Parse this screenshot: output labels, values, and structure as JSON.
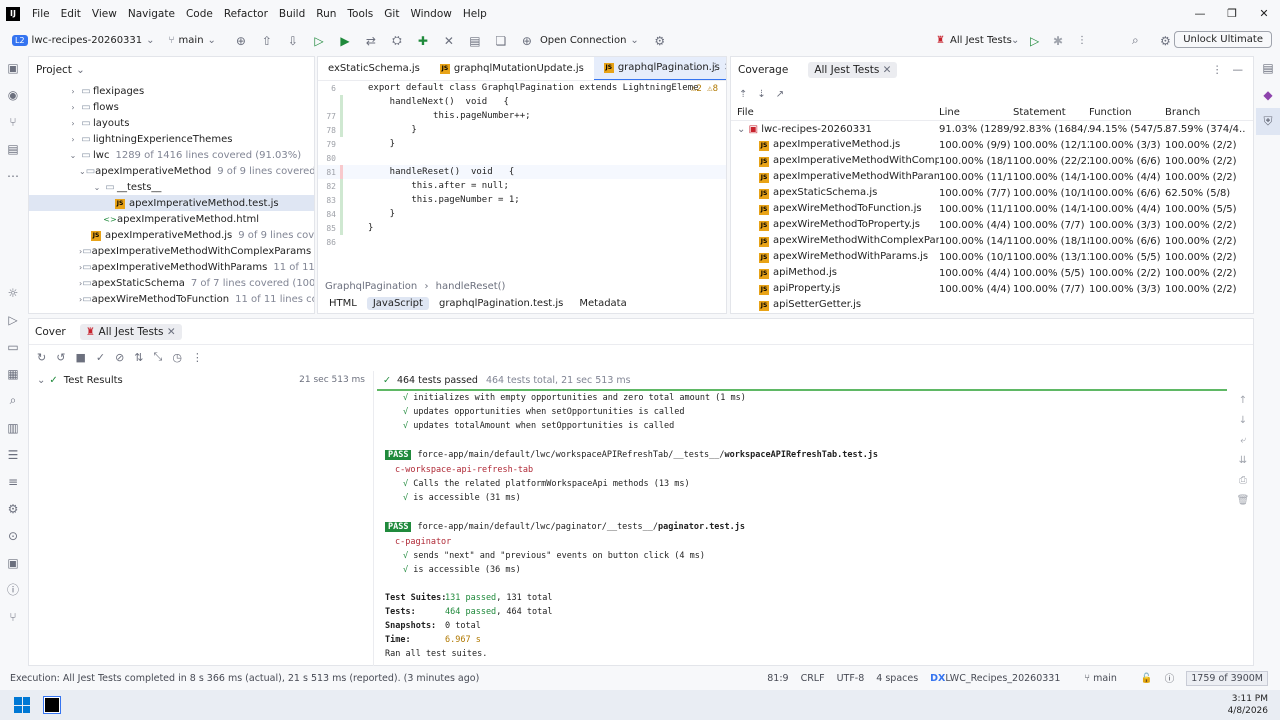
{
  "menu": {
    "logo": "IJ",
    "items": [
      "File",
      "Edit",
      "View",
      "Navigate",
      "Code",
      "Refactor",
      "Build",
      "Run",
      "Tools",
      "Git",
      "Window",
      "Help"
    ]
  },
  "toolbar": {
    "project_badge": "L2",
    "project_name": "lwc-recipes-20260331",
    "branch": "main",
    "open_connection": "Open Connection",
    "run_config": "All Jest Tests",
    "unlock": "Unlock Ultimate"
  },
  "project_panel": {
    "title": "Project",
    "rows": [
      {
        "indent": 4,
        "arrow": "›",
        "icon": "folder",
        "name": "flexipages",
        "note": ""
      },
      {
        "indent": 4,
        "arrow": "›",
        "icon": "folder",
        "name": "flows",
        "note": ""
      },
      {
        "indent": 4,
        "arrow": "›",
        "icon": "folder",
        "name": "layouts",
        "note": ""
      },
      {
        "indent": 4,
        "arrow": "›",
        "icon": "folder",
        "name": "lightningExperienceThemes",
        "note": ""
      },
      {
        "indent": 4,
        "arrow": "⌄",
        "icon": "folder",
        "name": "lwc",
        "note": "1289 of 1416 lines covered (91.03%)"
      },
      {
        "indent": 5,
        "arrow": "⌄",
        "icon": "folder",
        "name": "apexImperativeMethod",
        "note": "9 of 9 lines covered ("
      },
      {
        "indent": 6,
        "arrow": "⌄",
        "icon": "folder",
        "name": "__tests__",
        "note": ""
      },
      {
        "indent": 7,
        "arrow": "",
        "icon": "js",
        "name": "apexImperativeMethod.test.js",
        "note": "",
        "sel": true
      },
      {
        "indent": 6,
        "arrow": "",
        "icon": "html",
        "name": "apexImperativeMethod.html",
        "note": ""
      },
      {
        "indent": 6,
        "arrow": "",
        "icon": "js",
        "name": "apexImperativeMethod.js",
        "note": "9 of 9 lines cov"
      },
      {
        "indent": 5,
        "arrow": "›",
        "icon": "folder",
        "name": "apexImperativeMethodWithComplexParams",
        "note": "1"
      },
      {
        "indent": 5,
        "arrow": "›",
        "icon": "folder",
        "name": "apexImperativeMethodWithParams",
        "note": "11 of 11 lin"
      },
      {
        "indent": 5,
        "arrow": "›",
        "icon": "folder",
        "name": "apexStaticSchema",
        "note": "7 of 7 lines covered (100.0"
      },
      {
        "indent": 5,
        "arrow": "›",
        "icon": "folder",
        "name": "apexWireMethodToFunction",
        "note": "11 of 11 lines cov"
      }
    ]
  },
  "editor": {
    "tabs": [
      "exStaticSchema.js",
      "graphqlMutationUpdate.js",
      "graphqlPagination.js"
    ],
    "lines": [
      {
        "n": "6",
        "t": "export default class GraphqlPagination extends LightningEleme"
      },
      {
        "n": "",
        "t": "    handleNext()  void   {"
      },
      {
        "n": "77",
        "t": "            this.pageNumber++;"
      },
      {
        "n": "78",
        "t": "        }"
      },
      {
        "n": "79",
        "t": "    }"
      },
      {
        "n": "80",
        "t": ""
      },
      {
        "n": "81",
        "t": "    handleReset()  void   {"
      },
      {
        "n": "82",
        "t": "        this.after = null;"
      },
      {
        "n": "83",
        "t": "        this.pageNumber = 1;"
      },
      {
        "n": "84",
        "t": "    }"
      },
      {
        "n": "85",
        "t": "}"
      },
      {
        "n": "86",
        "t": ""
      }
    ],
    "warnings": "⚠2  ⚠8",
    "breadcrumb": [
      "GraphqlPagination",
      "handleReset()"
    ],
    "bottom_tabs": [
      "HTML",
      "JavaScript",
      "graphqlPagination.test.js",
      "Metadata"
    ]
  },
  "coverage": {
    "title": "Coverage",
    "tab": "All Jest Tests",
    "headers": [
      "File",
      "Line",
      "Statement",
      "Function",
      "Branch"
    ],
    "rows": [
      {
        "name": "lwc-recipes-20260331",
        "line": "91.03% (1289/1...",
        "stmt": "92.83% (1684/...",
        "func": "94.15% (547/5...",
        "branch": "87.59% (374/4...",
        "root": true
      },
      {
        "name": "apexImperativeMethod.js",
        "line": "100.00% (9/9)",
        "stmt": "100.00% (12/12)",
        "func": "100.00% (3/3)",
        "branch": "100.00% (2/2)"
      },
      {
        "name": "apexImperativeMethodWithComplexParar",
        "line": "100.00% (18/18)",
        "stmt": "100.00% (22/22)",
        "func": "100.00% (6/6)",
        "branch": "100.00% (2/2)"
      },
      {
        "name": "apexImperativeMethodWithParams.js",
        "line": "100.00% (11/11)",
        "stmt": "100.00% (14/14)",
        "func": "100.00% (4/4)",
        "branch": "100.00% (2/2)"
      },
      {
        "name": "apexStaticSchema.js",
        "line": "100.00% (7/7)",
        "stmt": "100.00% (10/10)",
        "func": "100.00% (6/6)",
        "branch": "62.50% (5/8)"
      },
      {
        "name": "apexWireMethodToFunction.js",
        "line": "100.00% (11/11)",
        "stmt": "100.00% (14/14)",
        "func": "100.00% (4/4)",
        "branch": "100.00% (5/5)"
      },
      {
        "name": "apexWireMethodToProperty.js",
        "line": "100.00% (4/4)",
        "stmt": "100.00% (7/7)",
        "func": "100.00% (3/3)",
        "branch": "100.00% (2/2)"
      },
      {
        "name": "apexWireMethodWithComplexParams.js",
        "line": "100.00% (14/14)",
        "stmt": "100.00% (18/18)",
        "func": "100.00% (6/6)",
        "branch": "100.00% (2/2)"
      },
      {
        "name": "apexWireMethodWithParams.js",
        "line": "100.00% (10/10)",
        "stmt": "100.00% (13/13)",
        "func": "100.00% (5/5)",
        "branch": "100.00% (2/2)"
      },
      {
        "name": "apiMethod.js",
        "line": "100.00% (4/4)",
        "stmt": "100.00% (5/5)",
        "func": "100.00% (2/2)",
        "branch": "100.00% (2/2)"
      },
      {
        "name": "apiProperty.js",
        "line": "100.00% (4/4)",
        "stmt": "100.00% (7/7)",
        "func": "100.00% (3/3)",
        "branch": "100.00% (2/2)"
      },
      {
        "name": "apiSetterGetter.js",
        "line": "",
        "stmt": "",
        "func": "",
        "branch": ""
      }
    ]
  },
  "test": {
    "tabs": [
      "Cover",
      "All Jest Tests"
    ],
    "results_label": "Test Results",
    "results_time": "21 sec 513 ms",
    "status": "464 tests passed",
    "status_detail": "464 tests total, 21 sec 513 ms",
    "console": [
      {
        "k": "chk",
        "t": "initializes with empty opportunities and zero total amount (1 ms)"
      },
      {
        "k": "chk",
        "t": "updates opportunities when setOpportunities is called"
      },
      {
        "k": "chk",
        "t": "updates totalAmount when setOpportunities is called"
      },
      {
        "k": "blank",
        "t": ""
      },
      {
        "k": "pass",
        "badge": "PASS",
        "path": "force-app/main/default/lwc/workspaceAPIRefreshTab/__tests__/",
        "file": "workspaceAPIRefreshTab.test.js"
      },
      {
        "k": "suite",
        "t": "c-workspace-api-refresh-tab"
      },
      {
        "k": "chk",
        "t": "Calls the related platformWorkspaceApi methods (13 ms)"
      },
      {
        "k": "chk",
        "t": "is accessible (31 ms)"
      },
      {
        "k": "blank",
        "t": ""
      },
      {
        "k": "pass",
        "badge": "PASS",
        "path": "force-app/main/default/lwc/paginator/__tests__/",
        "file": "paginator.test.js"
      },
      {
        "k": "suite",
        "t": "c-paginator"
      },
      {
        "k": "chk",
        "t": "sends \"next\" and \"previous\" events on button click (4 ms)"
      },
      {
        "k": "chk",
        "t": "is accessible (36 ms)"
      },
      {
        "k": "blank",
        "t": ""
      },
      {
        "k": "sum",
        "label": "Test Suites:",
        "a": "131 passed",
        "b": ", 131 total"
      },
      {
        "k": "sum",
        "label": "Tests:",
        "a": "464 passed",
        "b": ", 464 total"
      },
      {
        "k": "sum",
        "label": "Snapshots:",
        "a": "",
        "b": "0 total"
      },
      {
        "k": "time",
        "label": "Time:",
        "a": "6.967 s",
        "b": ""
      },
      {
        "k": "plain",
        "t": "Ran all test suites."
      }
    ]
  },
  "statusbar": {
    "message": "Execution: All Jest Tests completed in 8 s 366 ms (actual), 21 s 513 ms (reported). (3 minutes ago)",
    "pos": "81:9",
    "eol": "CRLF",
    "enc": "UTF-8",
    "indent": "4 spaces",
    "sf": "LWC_Recipes_20260331",
    "branch": "main",
    "mem": "1759 of 3900M"
  },
  "taskbar": {
    "time": "3:11 PM",
    "date": "4/8/2026"
  }
}
